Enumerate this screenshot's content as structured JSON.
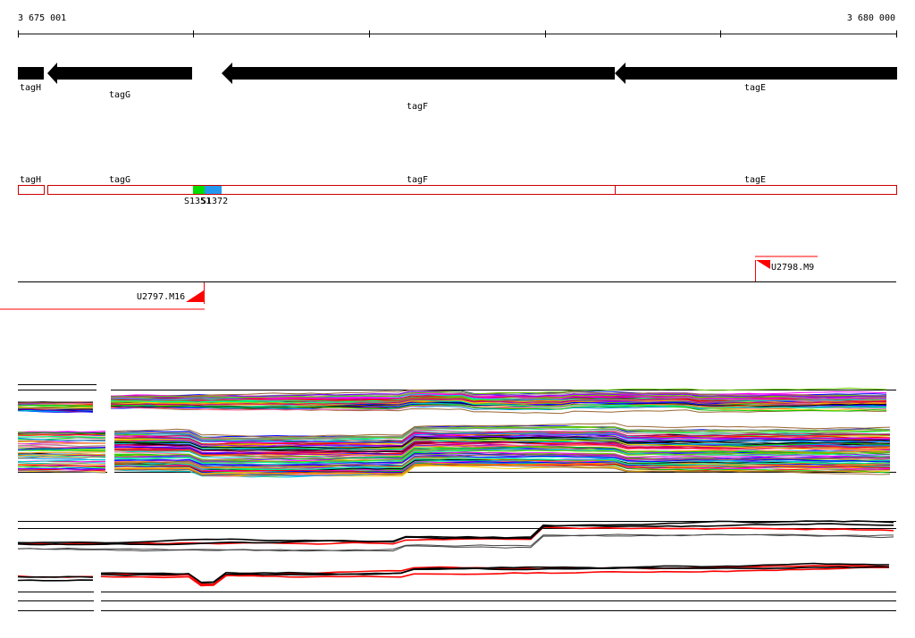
{
  "ruler": {
    "start_label": "3 675 001",
    "end_label": "3 680 000"
  },
  "genes": [
    {
      "name": "tagH",
      "strand": "-"
    },
    {
      "name": "tagG",
      "strand": "-"
    },
    {
      "name": "tagF",
      "strand": "-"
    },
    {
      "name": "tagE",
      "strand": "-"
    }
  ],
  "segments": {
    "labels": [
      "tagH",
      "tagG",
      "tagF",
      "tagE"
    ],
    "markers": [
      {
        "label": "S1351",
        "color": "#00dd00"
      },
      {
        "label": "S1372",
        "color": "#2299ee"
      }
    ]
  },
  "transcripts": [
    {
      "label": "U2798.M9"
    },
    {
      "label": "U2797.M16"
    }
  ],
  "colors": {
    "gene_fill": "#000000",
    "segment_outline": "#cc0000",
    "transcript_line": "#ff0000",
    "track_line": "#000000",
    "palette": [
      "#ff0000",
      "#00cc00",
      "#0000ff",
      "#ff00ff",
      "#00cccc",
      "#ffcc00",
      "#888888",
      "#ff8800",
      "#8800ff",
      "#00ff88",
      "#cc0066",
      "#66cc00",
      "#0088ff",
      "#000000",
      "#996633",
      "#ff6699"
    ]
  }
}
